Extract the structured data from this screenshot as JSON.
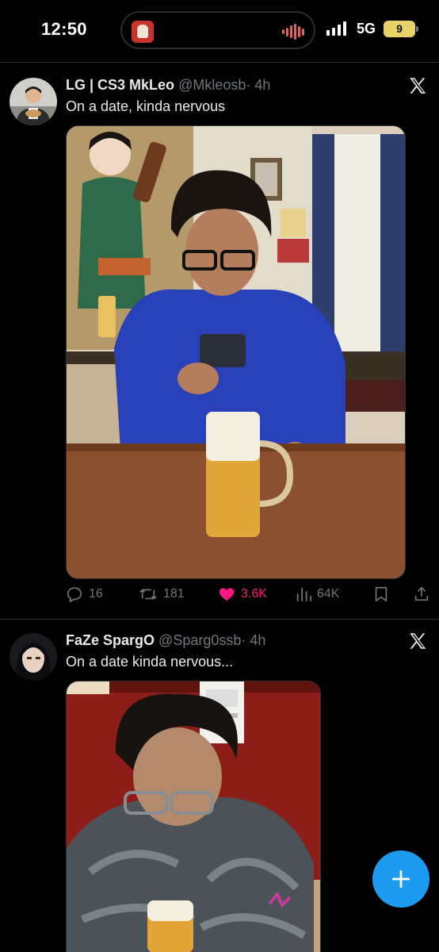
{
  "status_bar": {
    "time": "12:50",
    "network": "5G",
    "battery": "9",
    "icons": [
      "live-activity-app-icon",
      "audio-waveform-icon",
      "cellular-signal-icon",
      "battery-icon"
    ]
  },
  "colors": {
    "background": "#000000",
    "text": "#e7e9ea",
    "secondary_text": "#71767b",
    "divider": "#2f3336",
    "like": "#f91880",
    "accent": "#1d9bf0"
  },
  "tweets": [
    {
      "display_name": "LG | CS3 MkLeo",
      "handle": "@Mkleosb",
      "time": "· 4h",
      "text": "On a date, kinda nervous",
      "has_media": true,
      "actions": {
        "replies": "16",
        "retweets": "181",
        "likes": "3.6K",
        "views": "64K",
        "liked": true
      }
    },
    {
      "display_name": "FaZe SpargO",
      "handle": "@Sparg0ssb",
      "time": "· 4h",
      "text": "On a date kinda nervous...",
      "has_media": true
    }
  ],
  "fab": {
    "icon": "plus-icon"
  }
}
